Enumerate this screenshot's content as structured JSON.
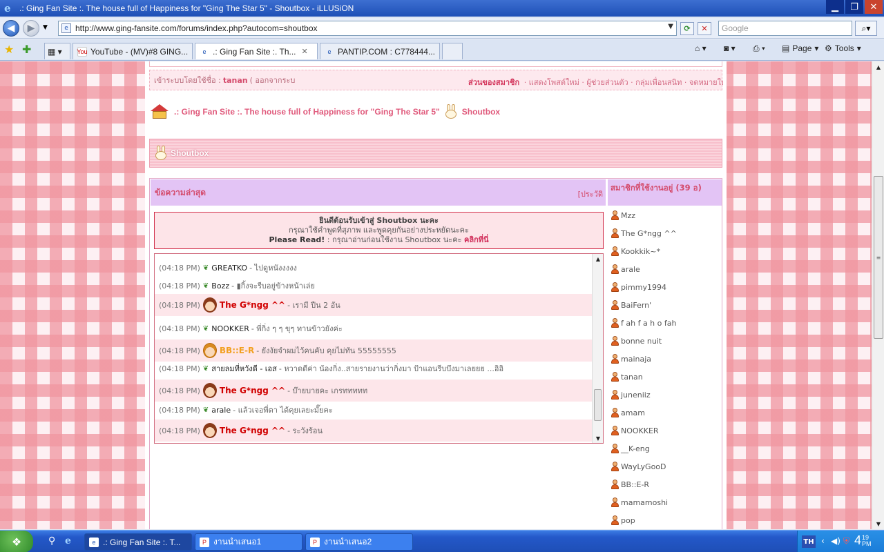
{
  "window": {
    "title": ".: Ging Fan Site :. The house full of Happiness for \"Ging The Star 5\" - Shoutbox - iLLUSiON",
    "minimize": "▁",
    "maximize": "❐",
    "close": "✕"
  },
  "address": {
    "url": "http://www.ging-fansite.com/forums/index.php?autocom=shoutbox",
    "search_placeholder": "Google"
  },
  "tabs": [
    {
      "label": "YouTube - (MV)#8 GING...",
      "icon": "youtube-icon"
    },
    {
      "label": ".: Ging Fan Site :. Th...",
      "icon": "ie-icon",
      "active": true
    },
    {
      "label": "PANTIP.COM : C778444...",
      "icon": "ie-icon"
    }
  ],
  "toolbar": {
    "page": "Page",
    "tools": "Tools"
  },
  "forum": {
    "login_prefix": "เข้าระบบโดยใช้ชื่อ :",
    "username": "tanan",
    "logout": "( ออกจากระบ",
    "member_area": "ส่วนของสมาชิก",
    "links": "· แสดงโพสต์ใหม่ · ผู้ช่วยส่วนตัว · กลุ่มเพื่อนสนิท · จดหมายใหม่",
    "breadcrumb_site": ".: Ging Fan Site :. The house full of Happiness for \"Ging The Star 5\"",
    "breadcrumb_page": "Shoutbox",
    "header": "Shoutbox"
  },
  "shoutbox": {
    "latest_label": "ข้อความล่าสุด",
    "history": "[ประวัติ",
    "online_label": "สมาชิกที่ใช้งานอยู่ (39 อ)",
    "welcome_title": "ยินดีต้อนรับเข้าสู่ Shoutbox นะคะ",
    "welcome_line2": "กรุณาใช้คำพูดที่สุภาพ และพูดคุยกันอย่างประหยัดนะคะ",
    "please_read": "Please Read!",
    "welcome_line3": ": กรุณาอ่านก่อนใช้งาน Shoutbox นะคะ",
    "click_here": "คลิกที่นี่"
  },
  "messages": [
    {
      "time": "(04:18 PM)",
      "name": "GREATKO",
      "text": "- ไปดูหนังงงงง",
      "style": "plain"
    },
    {
      "time": "(04:18 PM)",
      "name": "Bozz",
      "text": "- ▮กิ้งจะรีบอยู่ข้างหน้าเล่ย",
      "style": "plain"
    },
    {
      "time": "(04:18 PM)",
      "name": "The G*ngg ^^",
      "text": "- เรามี ปืน 2 อัน",
      "style": "red"
    },
    {
      "time": "(04:18 PM)",
      "name": "NOOKKER",
      "text": "- พี่กิ่ง ๆ ๆ ขุๆ ทานข้าวยังค่ะ",
      "style": "plain"
    },
    {
      "time": "(04:18 PM)",
      "name": "BB::E-R",
      "text": "- ยังงัยจำผมไว้คนคับ คุยไม่ทัน 55555555",
      "style": "orange"
    },
    {
      "time": "(04:18 PM)",
      "name": "สายลมที่หวังดี - เอส",
      "text": "- หวาดดีค่า น้องกิ่ง..สายรายงานว่ากิ่งมา ป้าแอนรีบบึงมาเลยยย ...อิอิ",
      "style": "plain"
    },
    {
      "time": "(04:18 PM)",
      "name": "The G*ngg ^^",
      "text": "- บ๊ายบายคะ เกรททททท",
      "style": "red"
    },
    {
      "time": "(04:18 PM)",
      "name": "arale",
      "text": "- แล้วเจอพี่ตา ได้คุยเลยะมั๊ยคะ",
      "style": "plain"
    },
    {
      "time": "(04:18 PM)",
      "name": "The G*ngg ^^",
      "text": "- ระวังร้อน",
      "style": "red"
    }
  ],
  "online_users": [
    "Mzz",
    "The G*ngg ^^",
    "Kookkik~*",
    "arale",
    "pimmy1994",
    "BaiFern'",
    "f ah f a h o fah",
    "bonne nuit",
    "mainaja",
    "tanan",
    "juneniiz",
    "amam",
    "NOOKKER",
    "__K-eng",
    "WayLyGooD",
    "BB::E-R",
    "mamamoshi",
    "pop"
  ],
  "taskbar": {
    "start": "❖",
    "items": [
      {
        "label": ".: Ging Fan Site :. T...",
        "active": true
      },
      {
        "label": "งานนำเสนอ1"
      },
      {
        "label": "งานนำเสนอ2"
      }
    ],
    "lang": "TH",
    "clock_h": "4",
    "clock_m": "19",
    "clock_ampm": "PM"
  }
}
